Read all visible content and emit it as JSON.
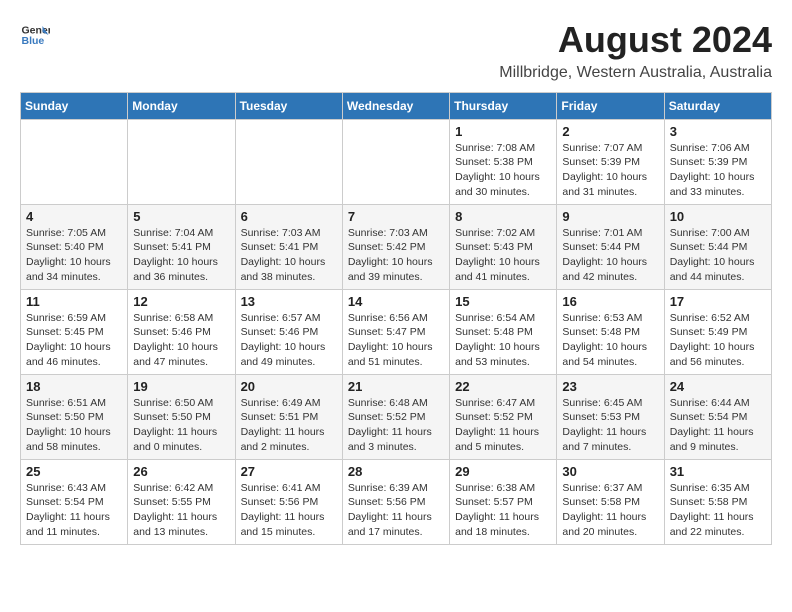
{
  "header": {
    "logo_general": "General",
    "logo_blue": "Blue",
    "main_title": "August 2024",
    "subtitle": "Millbridge, Western Australia, Australia"
  },
  "calendar": {
    "days_of_week": [
      "Sunday",
      "Monday",
      "Tuesday",
      "Wednesday",
      "Thursday",
      "Friday",
      "Saturday"
    ],
    "weeks": [
      [
        {
          "day": "",
          "detail": ""
        },
        {
          "day": "",
          "detail": ""
        },
        {
          "day": "",
          "detail": ""
        },
        {
          "day": "",
          "detail": ""
        },
        {
          "day": "1",
          "detail": "Sunrise: 7:08 AM\nSunset: 5:38 PM\nDaylight: 10 hours\nand 30 minutes."
        },
        {
          "day": "2",
          "detail": "Sunrise: 7:07 AM\nSunset: 5:39 PM\nDaylight: 10 hours\nand 31 minutes."
        },
        {
          "day": "3",
          "detail": "Sunrise: 7:06 AM\nSunset: 5:39 PM\nDaylight: 10 hours\nand 33 minutes."
        }
      ],
      [
        {
          "day": "4",
          "detail": "Sunrise: 7:05 AM\nSunset: 5:40 PM\nDaylight: 10 hours\nand 34 minutes."
        },
        {
          "day": "5",
          "detail": "Sunrise: 7:04 AM\nSunset: 5:41 PM\nDaylight: 10 hours\nand 36 minutes."
        },
        {
          "day": "6",
          "detail": "Sunrise: 7:03 AM\nSunset: 5:41 PM\nDaylight: 10 hours\nand 38 minutes."
        },
        {
          "day": "7",
          "detail": "Sunrise: 7:03 AM\nSunset: 5:42 PM\nDaylight: 10 hours\nand 39 minutes."
        },
        {
          "day": "8",
          "detail": "Sunrise: 7:02 AM\nSunset: 5:43 PM\nDaylight: 10 hours\nand 41 minutes."
        },
        {
          "day": "9",
          "detail": "Sunrise: 7:01 AM\nSunset: 5:44 PM\nDaylight: 10 hours\nand 42 minutes."
        },
        {
          "day": "10",
          "detail": "Sunrise: 7:00 AM\nSunset: 5:44 PM\nDaylight: 10 hours\nand 44 minutes."
        }
      ],
      [
        {
          "day": "11",
          "detail": "Sunrise: 6:59 AM\nSunset: 5:45 PM\nDaylight: 10 hours\nand 46 minutes."
        },
        {
          "day": "12",
          "detail": "Sunrise: 6:58 AM\nSunset: 5:46 PM\nDaylight: 10 hours\nand 47 minutes."
        },
        {
          "day": "13",
          "detail": "Sunrise: 6:57 AM\nSunset: 5:46 PM\nDaylight: 10 hours\nand 49 minutes."
        },
        {
          "day": "14",
          "detail": "Sunrise: 6:56 AM\nSunset: 5:47 PM\nDaylight: 10 hours\nand 51 minutes."
        },
        {
          "day": "15",
          "detail": "Sunrise: 6:54 AM\nSunset: 5:48 PM\nDaylight: 10 hours\nand 53 minutes."
        },
        {
          "day": "16",
          "detail": "Sunrise: 6:53 AM\nSunset: 5:48 PM\nDaylight: 10 hours\nand 54 minutes."
        },
        {
          "day": "17",
          "detail": "Sunrise: 6:52 AM\nSunset: 5:49 PM\nDaylight: 10 hours\nand 56 minutes."
        }
      ],
      [
        {
          "day": "18",
          "detail": "Sunrise: 6:51 AM\nSunset: 5:50 PM\nDaylight: 10 hours\nand 58 minutes."
        },
        {
          "day": "19",
          "detail": "Sunrise: 6:50 AM\nSunset: 5:50 PM\nDaylight: 11 hours\nand 0 minutes."
        },
        {
          "day": "20",
          "detail": "Sunrise: 6:49 AM\nSunset: 5:51 PM\nDaylight: 11 hours\nand 2 minutes."
        },
        {
          "day": "21",
          "detail": "Sunrise: 6:48 AM\nSunset: 5:52 PM\nDaylight: 11 hours\nand 3 minutes."
        },
        {
          "day": "22",
          "detail": "Sunrise: 6:47 AM\nSunset: 5:52 PM\nDaylight: 11 hours\nand 5 minutes."
        },
        {
          "day": "23",
          "detail": "Sunrise: 6:45 AM\nSunset: 5:53 PM\nDaylight: 11 hours\nand 7 minutes."
        },
        {
          "day": "24",
          "detail": "Sunrise: 6:44 AM\nSunset: 5:54 PM\nDaylight: 11 hours\nand 9 minutes."
        }
      ],
      [
        {
          "day": "25",
          "detail": "Sunrise: 6:43 AM\nSunset: 5:54 PM\nDaylight: 11 hours\nand 11 minutes."
        },
        {
          "day": "26",
          "detail": "Sunrise: 6:42 AM\nSunset: 5:55 PM\nDaylight: 11 hours\nand 13 minutes."
        },
        {
          "day": "27",
          "detail": "Sunrise: 6:41 AM\nSunset: 5:56 PM\nDaylight: 11 hours\nand 15 minutes."
        },
        {
          "day": "28",
          "detail": "Sunrise: 6:39 AM\nSunset: 5:56 PM\nDaylight: 11 hours\nand 17 minutes."
        },
        {
          "day": "29",
          "detail": "Sunrise: 6:38 AM\nSunset: 5:57 PM\nDaylight: 11 hours\nand 18 minutes."
        },
        {
          "day": "30",
          "detail": "Sunrise: 6:37 AM\nSunset: 5:58 PM\nDaylight: 11 hours\nand 20 minutes."
        },
        {
          "day": "31",
          "detail": "Sunrise: 6:35 AM\nSunset: 5:58 PM\nDaylight: 11 hours\nand 22 minutes."
        }
      ]
    ]
  }
}
